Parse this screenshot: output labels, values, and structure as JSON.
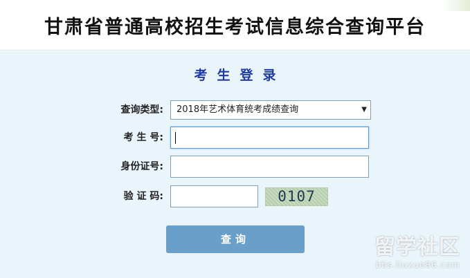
{
  "header": {
    "title": "甘肃省普通高校招生考试信息综合查询平台"
  },
  "login": {
    "title": "考生登录",
    "query_type": {
      "label": "查询类型:",
      "selected": "2018年艺术体育统考成绩查询"
    },
    "exam_number": {
      "label": "考 生 号:",
      "value": ""
    },
    "id_number": {
      "label": "身份证号:",
      "value": ""
    },
    "captcha": {
      "label": "验 证 码:",
      "value": "",
      "code": "0107"
    },
    "submit_label": "查询"
  },
  "watermark": {
    "text": "留学社区",
    "url": "bbs.liuxue86.com"
  },
  "colors": {
    "title_blue": "#1f3aa5",
    "button": "#6a9fc9",
    "panel_bg": "#eaf4fb"
  },
  "icons": {
    "select_arrow": "triangle-down-icon"
  }
}
